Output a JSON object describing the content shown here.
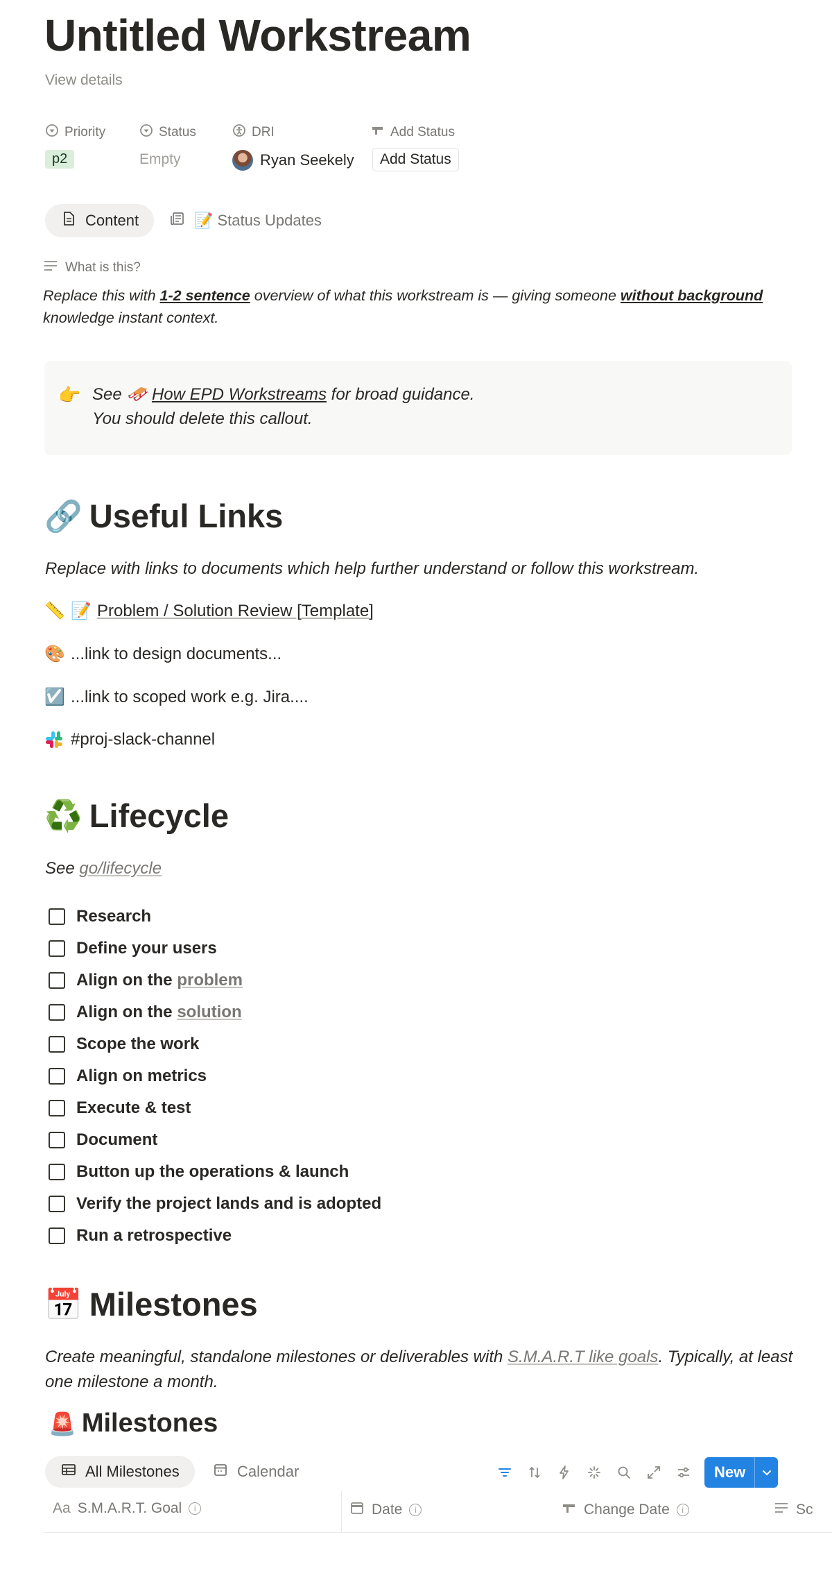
{
  "page": {
    "title": "Untitled Workstream",
    "view_details": "View details"
  },
  "properties": {
    "priority_label": "Priority",
    "priority_value": "p2",
    "status_label": "Status",
    "status_value": "Empty",
    "dri_label": "DRI",
    "dri_value": "Ryan Seekely",
    "add_status_label": "Add Status",
    "add_status_button": "Add Status"
  },
  "tabs": [
    {
      "label": "Content",
      "icon": "document-icon",
      "active": true
    },
    {
      "label": "📝 Status Updates",
      "icon": "newspaper-icon",
      "active": false
    }
  ],
  "what_is": {
    "label": "What is this?",
    "text_1": "Replace this with ",
    "bold_1": "1-2 sentence",
    "text_2": " overview of what this workstream is — giving someone ",
    "bold_2": "without background",
    "text_3": " knowledge instant context."
  },
  "callout": {
    "emoji": "👉",
    "see": "See",
    "link_emoji": "🛷",
    "link_text": "How EPD Workstreams",
    "suffix": " for broad guidance.",
    "line2": "You should delete this callout."
  },
  "useful_links": {
    "emoji": "🔗",
    "heading": "Useful Links",
    "intro": "Replace with links to documents which help further understand or follow this workstream.",
    "items": [
      {
        "emoji": "📏",
        "emoji2": "📝",
        "text": "Problem / Solution Review [Template]"
      },
      {
        "emoji": "🎨",
        "text": "...link to design documents..."
      },
      {
        "emoji": "☑️",
        "text": "...link to scoped work e.g. Jira...."
      },
      {
        "emoji": "#",
        "text": "#proj-slack-channel"
      }
    ]
  },
  "lifecycle": {
    "emoji": "♻️",
    "heading": "Lifecycle",
    "see": "See ",
    "link": "go/lifecycle",
    "items": [
      {
        "text": "Research",
        "link": ""
      },
      {
        "text": "Define your users",
        "link": ""
      },
      {
        "text": "Align on the ",
        "link": "problem"
      },
      {
        "text": "Align on the ",
        "link": "solution"
      },
      {
        "text": "Scope the work",
        "link": ""
      },
      {
        "text": "Align on metrics",
        "link": ""
      },
      {
        "text": "Execute & test",
        "link": ""
      },
      {
        "text": "Document",
        "link": ""
      },
      {
        "text": "Button up the operations & launch",
        "link": ""
      },
      {
        "text": "Verify the project lands and is adopted",
        "link": ""
      },
      {
        "text": "Run a retrospective",
        "link": ""
      }
    ]
  },
  "milestones": {
    "emoji": "📅",
    "heading": "Milestones",
    "intro_1": "Create meaningful, standalone milestones or deliverables with ",
    "intro_link": "S.M.A.R.T like goals",
    "intro_2": ". Typically, at least one milestone a month.",
    "db_emoji": "🚨",
    "db_title": "Milestones",
    "views": [
      {
        "label": "All Milestones",
        "active": true
      },
      {
        "label": "Calendar",
        "active": false
      }
    ],
    "new_button": "New",
    "columns": [
      {
        "label": "S.M.A.R.T. Goal",
        "icon": "text-aa-icon"
      },
      {
        "label": "Date",
        "icon": "calendar-icon"
      },
      {
        "label": "Change Date",
        "icon": "hand-pointer-icon"
      },
      {
        "label": "Sc",
        "icon": "lines-icon"
      }
    ]
  },
  "colors": {
    "accent": "#2383e2",
    "p2_bg": "#dbeddb",
    "text": "#2a2825",
    "muted": "#787774",
    "callout_bg": "#f8f8f7"
  }
}
